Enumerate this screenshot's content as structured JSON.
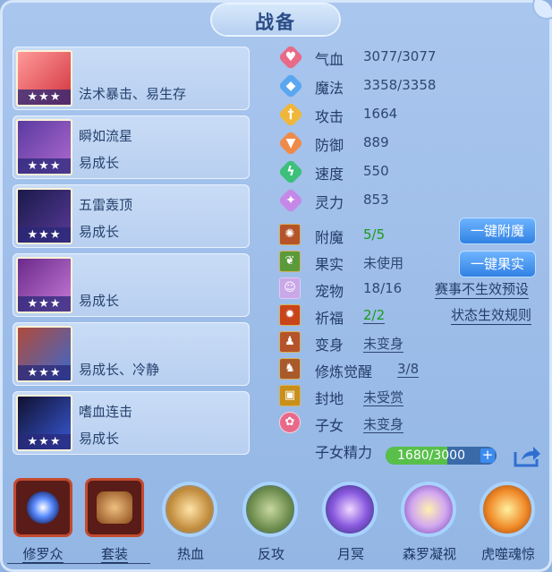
{
  "header": {
    "title": "战备"
  },
  "equipment": [
    {
      "name": "",
      "trait": "法术暴击、易生存",
      "stars": "★★★"
    },
    {
      "name": "瞬如流星",
      "trait": "易成长",
      "stars": "★★★"
    },
    {
      "name": "五雷轰顶",
      "trait": "易成长",
      "stars": "★★★"
    },
    {
      "name": "",
      "trait": "易成长",
      "stars": "★★★"
    },
    {
      "name": "",
      "trait": "易成长、冷静",
      "stars": "★★★"
    },
    {
      "name": "嗜血连击",
      "trait": "易成长",
      "stars": "★★★"
    }
  ],
  "stats": [
    {
      "label": "气血",
      "value": "3077/3077",
      "color": "#e96a86",
      "glyph": "♥"
    },
    {
      "label": "魔法",
      "value": "3358/3358",
      "color": "#5aa6f0",
      "glyph": "◆"
    },
    {
      "label": "攻击",
      "value": "1664",
      "color": "#f0b63a",
      "glyph": "†"
    },
    {
      "label": "防御",
      "value": "889",
      "color": "#f08a48",
      "glyph": "▼"
    },
    {
      "label": "速度",
      "value": "550",
      "color": "#3cc07a",
      "glyph": "ϟ"
    },
    {
      "label": "灵力",
      "value": "853",
      "color": "#c588e8",
      "glyph": "✦"
    }
  ],
  "extras": {
    "enchant": {
      "label": "附魔",
      "value": "5/5",
      "button": "一键附魔"
    },
    "fruit": {
      "label": "果实",
      "value": "未使用",
      "button": "一键果实"
    },
    "pet": {
      "label": "宠物",
      "value": "18/16",
      "link": "赛事不生效预设"
    },
    "bless": {
      "label": "祈福",
      "value": "2/2",
      "link": "状态生效规则"
    },
    "transform": {
      "label": "变身",
      "value": "未变身"
    },
    "cultivate": {
      "label": "修炼觉醒",
      "value": "3/8"
    },
    "fief": {
      "label": "封地",
      "value": "未受赏"
    },
    "child": {
      "label": "子女",
      "value": "未变身"
    }
  },
  "child_energy": {
    "label": "子女精力",
    "text": "1680/3000",
    "level": 0.56,
    "plus": "+"
  },
  "bottom_bar": [
    {
      "label": "修罗众",
      "style": "square",
      "color": "#3b6be8"
    },
    {
      "label": "套装",
      "style": "square",
      "color": "#b47a3a"
    },
    {
      "label": "热血",
      "style": "round",
      "color": "#e8b45a"
    },
    {
      "label": "反攻",
      "style": "round",
      "color": "#6a8a4a"
    },
    {
      "label": "月冥",
      "style": "round",
      "color": "#8a5ae0"
    },
    {
      "label": "森罗凝视",
      "style": "round",
      "color": "#d2a8f0"
    },
    {
      "label": "虎噬魂惊",
      "style": "round",
      "color": "#f08a28"
    }
  ]
}
